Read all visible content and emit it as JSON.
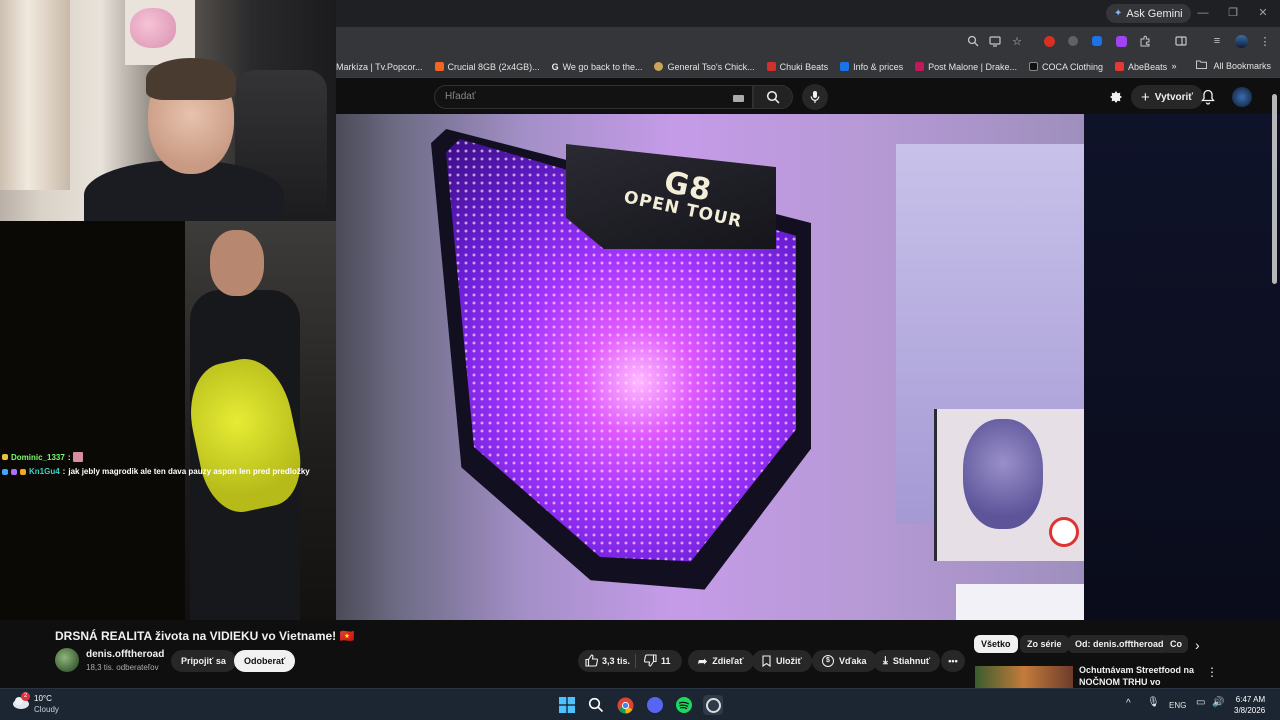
{
  "browser": {
    "ask_gemini": "Ask Gemini",
    "bookmarks": [
      {
        "label": "Markíza | Tv.Popcor...",
        "color": "#3a3a3a"
      },
      {
        "label": "Crucial 8GB (2x4GB)...",
        "color": "#f26522"
      },
      {
        "label": "We go back to the...",
        "color": "#4285f4",
        "glyph": "G"
      },
      {
        "label": "General Tso's Chick...",
        "color": "#c9a45a"
      },
      {
        "label": "Chuki Beats",
        "color": "#d0312d"
      },
      {
        "label": "Info & prices",
        "color": "#1a73e8",
        "glyph": "B."
      },
      {
        "label": "Post Malone | Drake...",
        "color": "#c2185b"
      },
      {
        "label": "COCA Clothing",
        "color": "#111111"
      },
      {
        "label": "AbeBeats",
        "color": "#e53935"
      }
    ],
    "all_bookmarks": "All Bookmarks"
  },
  "youtube": {
    "search_placeholder": "Hľadať",
    "create_label": "Vytvoriť"
  },
  "chat": [
    {
      "user": "Dominic_1337",
      "text": ""
    },
    {
      "user": "Kn1Gu4",
      "text": "jak jebly magrodik ale ten dava pauzy aspon len pred predložky"
    }
  ],
  "video": {
    "sign_line1": "G8",
    "sign_line2": "OPEN TOUR"
  },
  "below": {
    "title": "DRSNÁ REALITA života na VIDIEKU vo Vietname! 🇻🇳",
    "channel_name": "denis.offtheroad",
    "subscribers": "18,3 tis. odberateľov",
    "join": "Pripojiť sa",
    "unsubscribe": "Odoberať",
    "likes": "3,3 tis.",
    "dislikes": "11",
    "share": "Zdieľať",
    "save": "Uložiť",
    "thanks": "Vďaka",
    "download": "Stiahnuť",
    "chips": [
      "Všetko",
      "Zo série",
      "Od: denis.offtheroad",
      "Co"
    ],
    "rec_title": "Ochutnávam Streetfood na NOČNOM TRHU vo Vietname! ..."
  },
  "taskbar": {
    "temp": "10°C",
    "weather": "Cloudy",
    "weather_badge": "2",
    "lang": "ENG",
    "time": "6:47 AM",
    "date": "3/8/2026"
  }
}
